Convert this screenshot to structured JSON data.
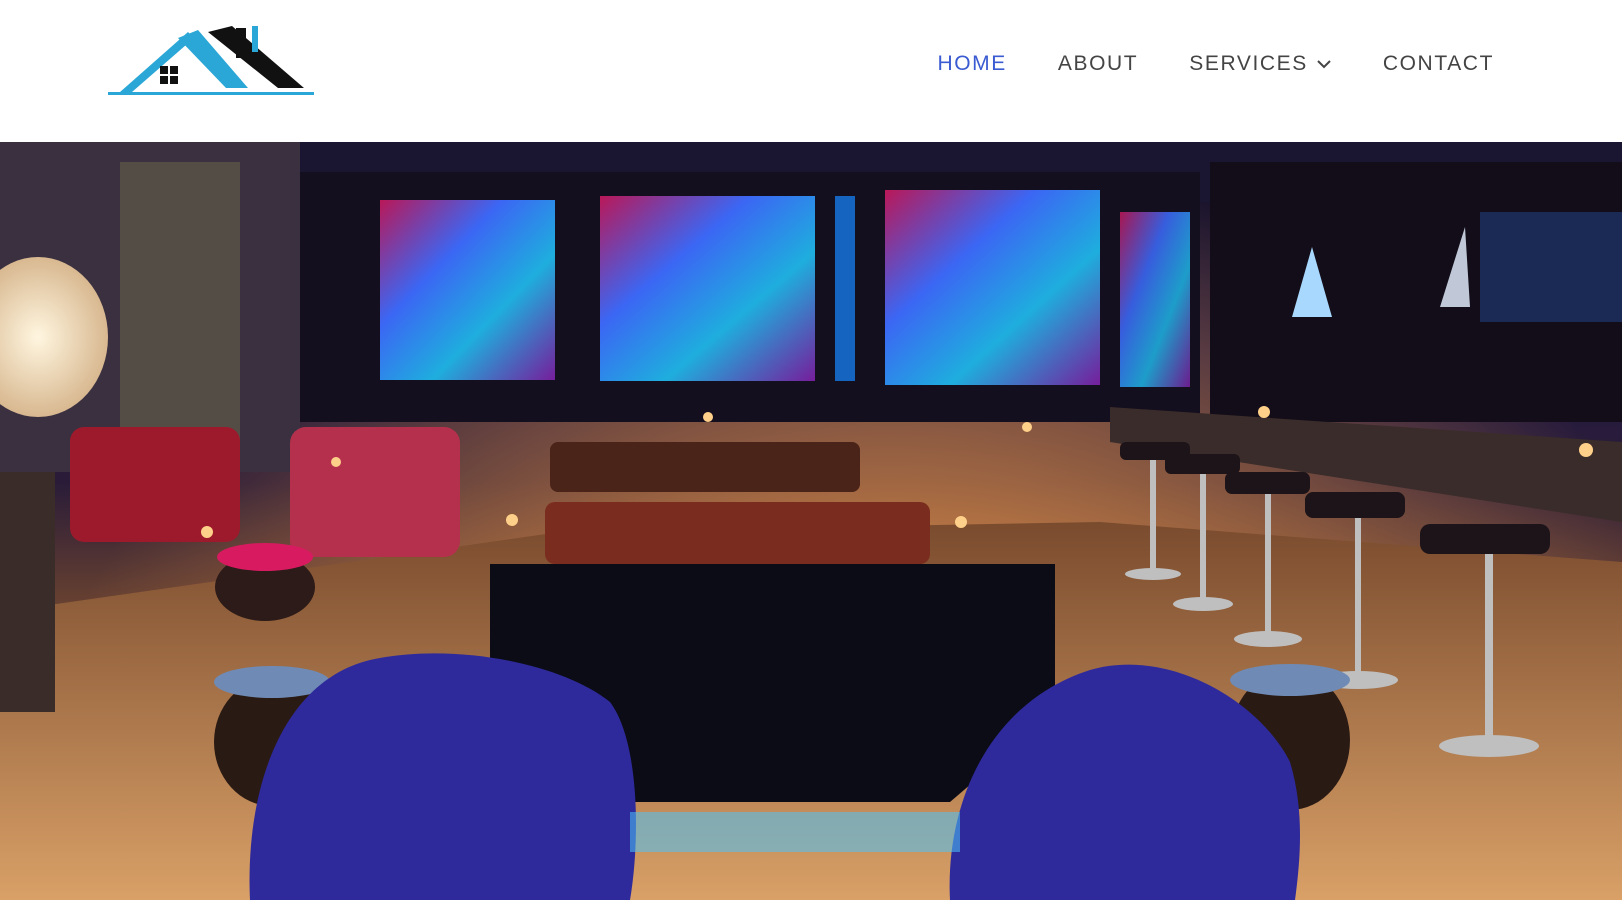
{
  "header": {
    "logo_icon": "house-roof-logo",
    "nav": [
      {
        "label": "HOME",
        "active": true
      },
      {
        "label": "ABOUT",
        "active": false
      },
      {
        "label": "SERVICES",
        "active": false,
        "has_dropdown": true
      },
      {
        "label": "CONTACT",
        "active": false
      }
    ]
  },
  "hero": {
    "image": "hero-lounge-photo"
  },
  "colors": {
    "nav_active": "#3a5bd1",
    "nav_text": "#444444",
    "logo_blue": "#2aa7d6",
    "logo_dark": "#111111"
  }
}
